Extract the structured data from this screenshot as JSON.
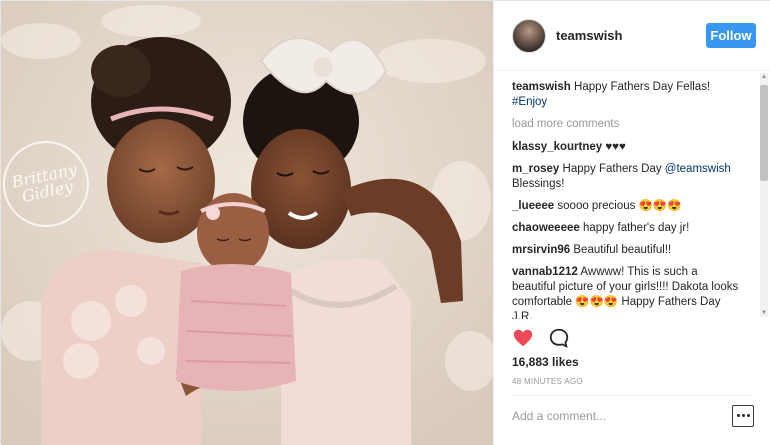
{
  "post": {
    "author": "teamswish",
    "follow_label": "Follow",
    "caption_user": "teamswish",
    "caption_text": "Happy Fathers Day Fellas!",
    "caption_hashtag": "#Enjoy",
    "load_more_label": "load more comments",
    "comments": [
      {
        "user": "klassy_kourtney",
        "text": "♥♥♥"
      },
      {
        "user": "m_rosey",
        "text": "Happy Fathers Day ",
        "mention": "@teamswish",
        "text_after": " Blessings!"
      },
      {
        "user": "_lueeee",
        "text": "soooo precious 😍😍😍"
      },
      {
        "user": "chaoweeeee",
        "text": "happy father's day jr!"
      },
      {
        "user": "mrsirvin96",
        "text": "Beautiful beautiful!!"
      },
      {
        "user": "vannab1212",
        "text": "Awwww! This is such a beautiful picture of your girls!!!! Dakota looks comfortable 😍😍😍 Happy Fathers Day J.R."
      }
    ],
    "likes": "16,883 likes",
    "time": "48 MINUTES AGO",
    "comment_placeholder": "Add a comment...",
    "watermark_line1": "Brittany",
    "watermark_line2": "Gidley",
    "icons": {
      "like": "heart-icon",
      "comment": "speech-bubble-icon",
      "more": "more-options-icon"
    },
    "colors": {
      "follow": "#3897f0",
      "like": "#ed4956",
      "link": "#003569"
    }
  }
}
